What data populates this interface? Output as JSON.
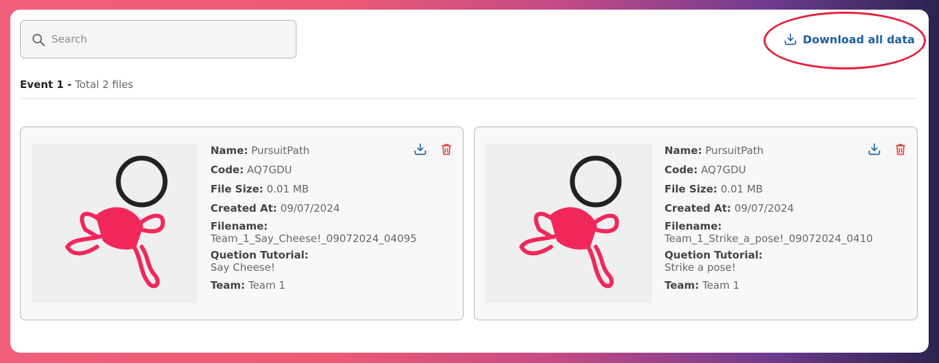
{
  "search": {
    "placeholder": "Search",
    "value": ""
  },
  "toolbar": {
    "download_all_label": "Download all data"
  },
  "event": {
    "name": "Event 1 -",
    "total": "Total 2 files"
  },
  "labels": {
    "name": "Name:",
    "code": "Code:",
    "file_size": "File Size:",
    "created_at": "Created At:",
    "filename": "Filename:",
    "question_tutorial": "Quetion Tutorial:",
    "team": "Team:"
  },
  "files": [
    {
      "name": "PursuitPath",
      "code": "AQ7GDU",
      "file_size": "0.01 MB",
      "created_at": "09/07/2024",
      "filename": "Team_1_Say_Cheese!_09072024_04095",
      "question_tutorial": "Say Cheese!",
      "team": "Team 1"
    },
    {
      "name": "PursuitPath",
      "code": "AQ7GDU",
      "file_size": "0.01 MB",
      "created_at": "09/07/2024",
      "filename": "Team_1_Strike_a_pose!_09072024_0410",
      "question_tutorial": "Strike a pose!",
      "team": "Team 1"
    }
  ],
  "colors": {
    "accent": "#1e5fa0",
    "delete": "#e0453f",
    "highlight": "#e5203c",
    "runner": "#f0285a"
  }
}
